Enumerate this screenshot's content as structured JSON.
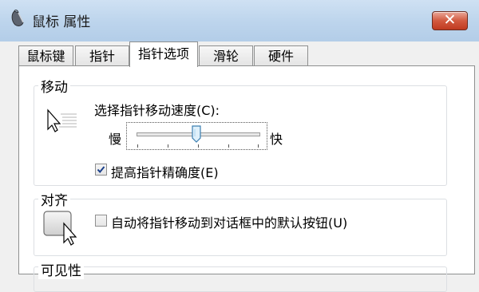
{
  "window": {
    "title": "鼠标 属性",
    "close_label": "✕"
  },
  "tabs": [
    {
      "label": "鼠标键",
      "active": false
    },
    {
      "label": "指针",
      "active": false
    },
    {
      "label": "指针选项",
      "active": true
    },
    {
      "label": "滑轮",
      "active": false
    },
    {
      "label": "硬件",
      "active": false
    }
  ],
  "motion": {
    "group_label": "移动",
    "speed_label": "选择指针移动速度(C):",
    "slow_label": "慢",
    "fast_label": "快",
    "speed_level": 0.45,
    "precision_label": "提高指针精确度(E)",
    "precision_checked": true
  },
  "snap": {
    "group_label": "对齐",
    "snap_label": "自动将指针移动到对话框中的默认按钮(U)",
    "snap_checked": false
  },
  "visibility": {
    "group_label": "可见性"
  }
}
